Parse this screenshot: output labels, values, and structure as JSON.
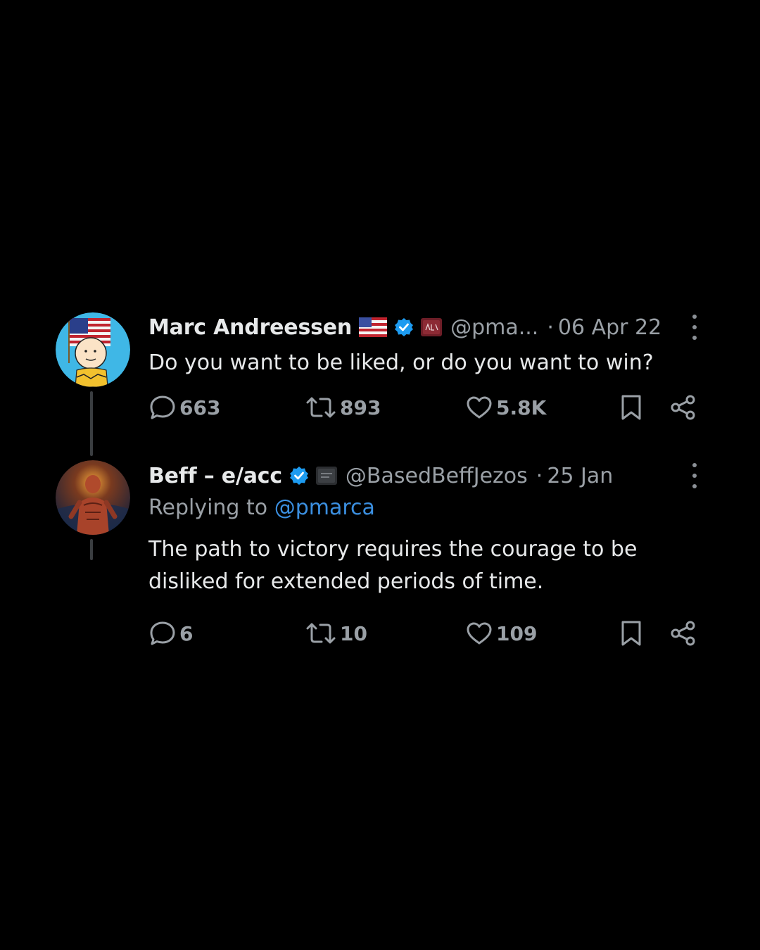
{
  "colors": {
    "background": "#000000",
    "text_primary": "#e7e9ea",
    "text_secondary": "#9aa0a6",
    "link": "#3b8fe0",
    "verified": "#1d9bf0"
  },
  "tweets": [
    {
      "author_name": "Marc Andreessen",
      "badges": [
        "us-flag-emoji",
        "verified-badge",
        "affiliate-badge"
      ],
      "handle": "@pma...",
      "separator": "·",
      "date": "06 Apr 22",
      "text": "Do you want to be liked, or do you want to win?",
      "replies": "663",
      "reposts": "893",
      "likes": "5.8K"
    },
    {
      "author_name": "Beff – e/acc",
      "badges": [
        "verified-badge",
        "affiliate-badge"
      ],
      "handle": "@BasedBeffJezos",
      "separator": "·",
      "date": "25 Jan",
      "replying_label": "Replying to",
      "replying_to": "@pmarca",
      "text_line1": "The path to victory requires the courage to be",
      "text_line2": "disliked for extended periods of time.",
      "replies": "6",
      "reposts": "10",
      "likes": "109"
    }
  ]
}
